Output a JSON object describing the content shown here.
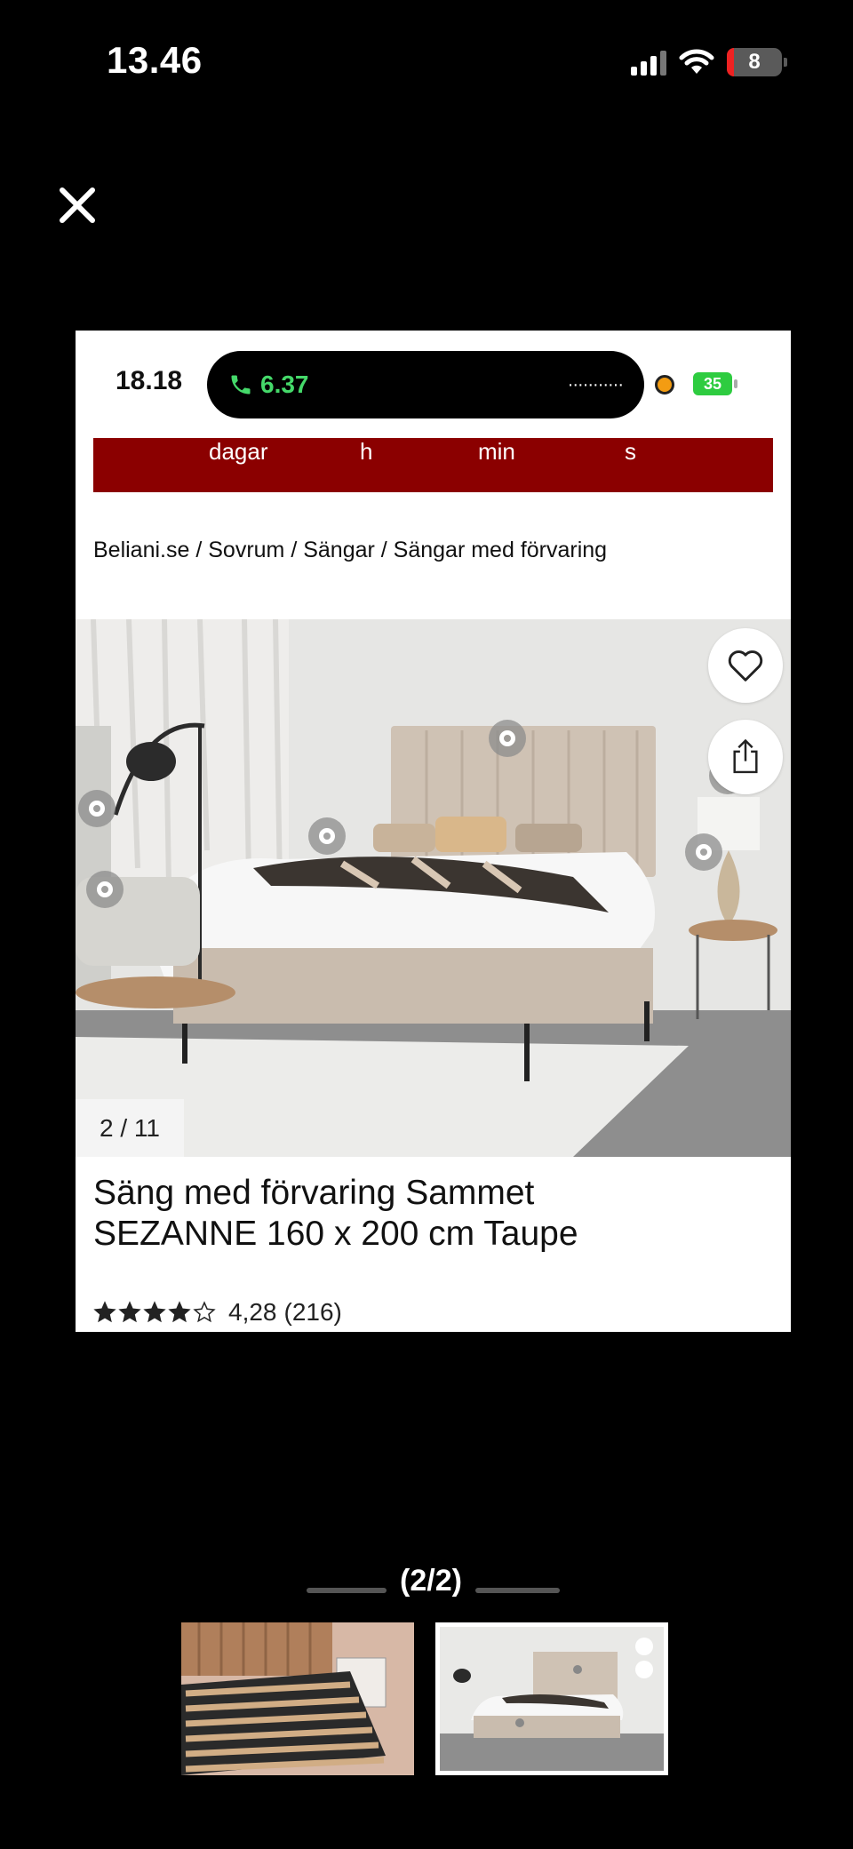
{
  "os_status": {
    "time": "13.46",
    "battery": "8"
  },
  "viewer": {
    "close_label": "×",
    "pager": "(2/2)"
  },
  "inner_status": {
    "time": "18.18",
    "call_time": "6.37",
    "dots": "···········",
    "battery": "35"
  },
  "countdown": {
    "labels": [
      "dagar",
      "h",
      "min",
      "s"
    ],
    "bg_color": "#8b0000"
  },
  "breadcrumb": "Beliani.se / Sovrum / Sängar / Sängar med förvaring",
  "gallery": {
    "counter": "2 / 11"
  },
  "product": {
    "title_line1": "Säng med förvaring Sammet",
    "title_line2": "SEZANNE 160 x 200 cm Taupe",
    "rating_value": "4,28",
    "rating_count": "(216)",
    "stars_filled": 4,
    "stars_total": 5
  },
  "thumbnails": [
    {
      "name": "bed-frame-slats",
      "active": false
    },
    {
      "name": "bed-room-scene",
      "active": true
    }
  ]
}
